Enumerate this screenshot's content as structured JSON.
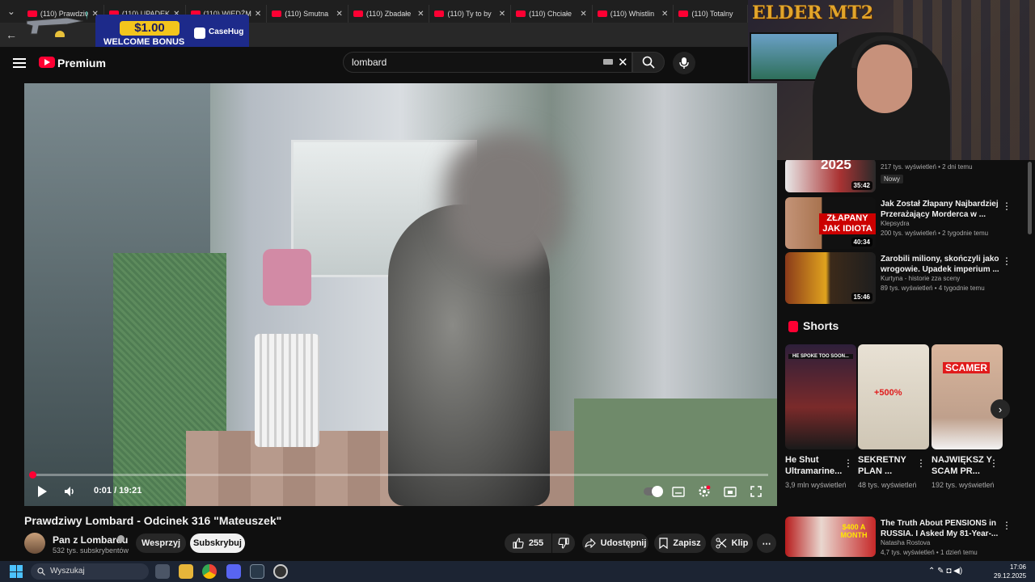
{
  "browser": {
    "tabs": [
      {
        "label": "(110) Prawdziw"
      },
      {
        "label": "(110) UPADEK"
      },
      {
        "label": "(110) WIEDŹM"
      },
      {
        "label": "(110) Smutna"
      },
      {
        "label": "(110) Zbadałe"
      },
      {
        "label": "(110) Ty to by"
      },
      {
        "label": "(110) Chciałe"
      },
      {
        "label": "(110) Whistlin"
      },
      {
        "label": "(110) Totalny"
      }
    ],
    "close_glyph": "✕",
    "menu_glyph": "⌄",
    "back_glyph": "←"
  },
  "promo": {
    "amount": "$1.00",
    "text": "WELCOME BONUS",
    "brand": "CaseHug"
  },
  "header": {
    "logo_text": "Premium",
    "search_value": "lombard",
    "clear_glyph": "✕"
  },
  "webcam": {
    "logo": "ELDER MT2"
  },
  "player": {
    "current_time": "0:01",
    "duration": "19:21",
    "time_text": "0:01 / 19:21",
    "progress_fraction": 0.001
  },
  "video": {
    "title": "Prawdziwy Lombard - Odcinek 316 \"Mateuszek\"",
    "channel": "Pan z Lombardu",
    "subscribers": "532 tys. subskrybentów",
    "join_label": "Wesprzyj",
    "subscribe_label": "Subskrybuj",
    "likes": "255",
    "share_label": "Udostępnij",
    "save_label": "Zapisz",
    "clip_label": "Klip",
    "more_glyph": "⋯"
  },
  "sidebar": {
    "videos": [
      {
        "title": "",
        "channel": "",
        "meta": "217 tys. wyświetleń • 2 dni temu",
        "badge": "Nowy",
        "duration": "35:42",
        "thumb_text": "2025"
      },
      {
        "title": "Jak Został Złapany Najbardziej Przerażający Morderca w ...",
        "channel": "Klepsydra",
        "meta": "200 tys. wyświetleń • 2 tygodnie temu",
        "duration": "40:34",
        "thumb_text": "ZŁAPANY JAK IDIOTA"
      },
      {
        "title": "Zarobili miliony, skończyli jako wrogowie. Upadek imperium ...",
        "channel": "Kurtyna - historie zza sceny",
        "meta": "89 tys. wyświetleń • 4 tygodnie temu",
        "duration": "15:46",
        "thumb_text": ""
      },
      {
        "title": "The Truth About PENSIONS in RUSSIA. I Asked My 81-Year-...",
        "channel": "Natasha Rostova",
        "meta": "4,7 tys. wyświetleń • 1 dzień temu",
        "duration": "",
        "thumb_text": "$400 A MONTH"
      }
    ],
    "more_glyph": "⋮",
    "shorts_title": "Shorts",
    "shorts": [
      {
        "title": "He Shut Ultramarine...",
        "views": "3,9 mln wyświetleń",
        "thumb_text": "HE SPOKE TOO SOON..."
      },
      {
        "title": "SEKRETNY PLAN ...",
        "views": "48 tys. wyświetleń",
        "thumb_text": "+500%"
      },
      {
        "title": "NAJWIĘKSZ Y SCAM PR...",
        "views": "192 tys. wyświetleń",
        "thumb_text": "SCAMER"
      }
    ],
    "next_glyph": "›"
  },
  "taskbar": {
    "search_label": "Wyszukaj",
    "time": "17:06",
    "date": "29.12.2025"
  }
}
